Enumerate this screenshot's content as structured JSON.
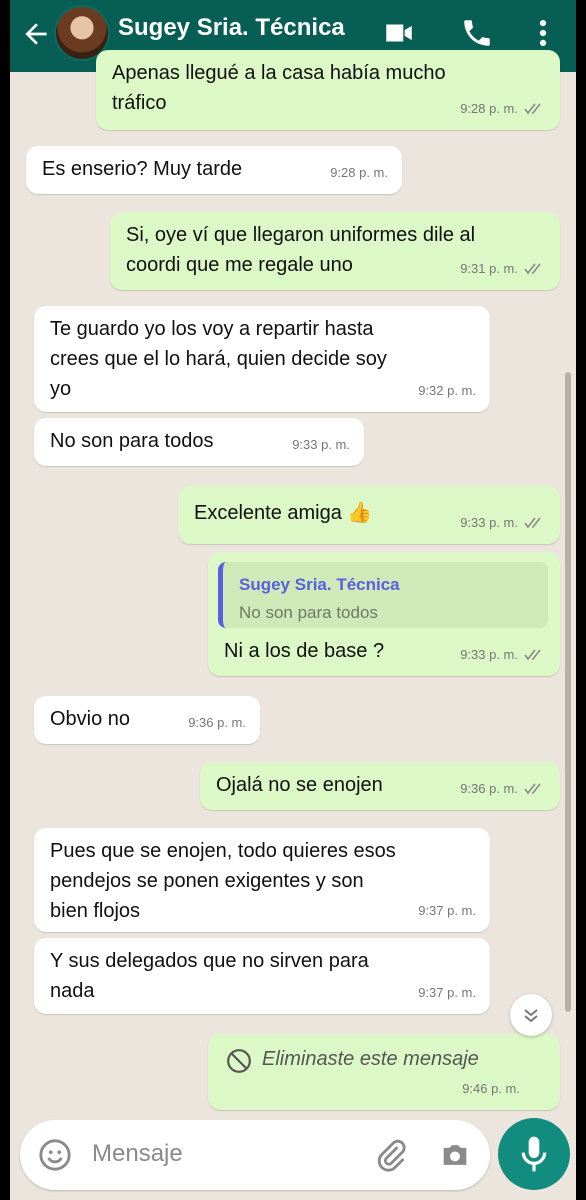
{
  "header": {
    "contact_name": "Sugey Sria. Técnica"
  },
  "messages": [
    {
      "dir": "out",
      "text": "Apenas llegué a la casa había mucho\ntráfico",
      "time": "9:28 p. m."
    },
    {
      "dir": "in",
      "text": "Es enserio? Muy tarde",
      "time": "9:28 p. m."
    },
    {
      "dir": "out",
      "text": "Si, oye ví que llegaron uniformes dile al\ncoordi que me regale uno",
      "time": "9:31 p. m."
    },
    {
      "dir": "in",
      "text": "Te guardo yo los voy a repartir hasta\ncrees que el lo hará, quien decide soy\nyo",
      "time": "9:32 p. m."
    },
    {
      "dir": "in",
      "text": "No son para todos",
      "time": "9:33 p. m."
    },
    {
      "dir": "out",
      "text": "Excelente amiga 👍",
      "time": "9:33 p. m."
    },
    {
      "dir": "out",
      "quote_name": "Sugey Sria. Técnica",
      "quote_text": "No son para todos",
      "text": "Ni a los de base ?",
      "time": "9:33 p. m."
    },
    {
      "dir": "in",
      "text": "Obvio no",
      "time": "9:36 p. m."
    },
    {
      "dir": "out",
      "text": "Ojalá no se enojen",
      "time": "9:36 p. m."
    },
    {
      "dir": "in",
      "text": "Pues que se enojen, todo quieres esos\npendejos se ponen exigentes y son\nbien flojos",
      "time": "9:37 p. m."
    },
    {
      "dir": "in",
      "text": "Y sus delegados que no sirven para\nnada",
      "time": "9:37 p. m."
    },
    {
      "dir": "out",
      "text": "Eliminaste este mensaje",
      "time": "9:46 p. m."
    }
  ],
  "input": {
    "placeholder": "Mensaje"
  },
  "colors": {
    "header": "#075e54",
    "outgoing": "#dcf8c6",
    "incoming": "#ffffff",
    "background": "#ece5dd",
    "accent": "#128c7e"
  }
}
